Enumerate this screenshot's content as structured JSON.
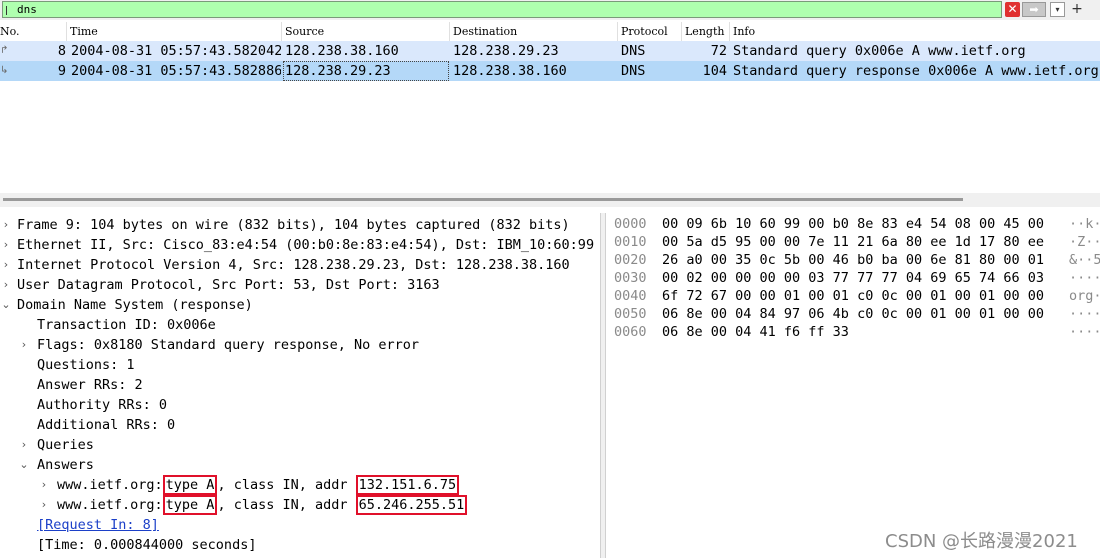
{
  "filter": {
    "value": "dns",
    "clear_icon": "✕",
    "apply_icon": "➡",
    "dropdown_icon": "▾",
    "add_icon": "+"
  },
  "columns": {
    "no": "No.",
    "time": "Time",
    "source": "Source",
    "destination": "Destination",
    "protocol": "Protocol",
    "length": "Length",
    "info": "Info"
  },
  "packets": [
    {
      "no": "8",
      "time": "2004-08-31 05:57:43.582042",
      "source": "128.238.38.160",
      "destination": "128.238.29.23",
      "protocol": "DNS",
      "length": "72",
      "info": "Standard query 0x006e A www.ietf.org"
    },
    {
      "no": "9",
      "time": "2004-08-31 05:57:43.582886",
      "source": "128.238.29.23",
      "destination": "128.238.38.160",
      "protocol": "DNS",
      "length": "104",
      "info": "Standard query response 0x006e A www.ietf.org"
    }
  ],
  "details": {
    "frame": "Frame 9: 104 bytes on wire (832 bits), 104 bytes captured (832 bits)",
    "ethernet": "Ethernet II, Src: Cisco_83:e4:54 (00:b0:8e:83:e4:54), Dst: IBM_10:60:99 (",
    "ip": "Internet Protocol Version 4, Src: 128.238.29.23, Dst: 128.238.38.160",
    "udp": "User Datagram Protocol, Src Port: 53, Dst Port: 3163",
    "dns": "Domain Name System (response)",
    "transaction_id": "Transaction ID: 0x006e",
    "flags": "Flags: 0x8180 Standard query response, No error",
    "questions": "Questions: 1",
    "answer_rrs": "Answer RRs: 2",
    "authority_rrs": "Authority RRs: 0",
    "additional_rrs": "Additional RRs: 0",
    "queries": "Queries",
    "answers": "Answers",
    "answer_list": [
      {
        "name": "www.ietf.org:",
        "type": "type A",
        "class": ", class IN, addr",
        "addr": "132.151.6.75"
      },
      {
        "name": "www.ietf.org:",
        "type": "type A",
        "class": ", class IN, addr",
        "addr": "65.246.255.51"
      }
    ],
    "request_in": "[Request In: 8]",
    "time": "[Time: 0.000844000 seconds]"
  },
  "bytes": [
    {
      "offset": "0000",
      "hex": "00 09 6b 10 60 99 00 b0  8e 83 e4 54 08 00 45 00",
      "ascii": "··k·"
    },
    {
      "offset": "0010",
      "hex": "00 5a d5 95 00 00 7e 11  21 6a 80 ee 1d 17 80 ee",
      "ascii": "·Z··"
    },
    {
      "offset": "0020",
      "hex": "26 a0 00 35 0c 5b 00 46  b0 ba 00 6e 81 80 00 01",
      "ascii": "&··5"
    },
    {
      "offset": "0030",
      "hex": "00 02 00 00 00 00 03 77  77 77 04 69 65 74 66 03",
      "ascii": "····"
    },
    {
      "offset": "0040",
      "hex": "6f 72 67 00 00 01 00 01  c0 0c 00 01 00 01 00 00",
      "ascii": "org·"
    },
    {
      "offset": "0050",
      "hex": "06 8e 00 04 84 97 06 4b  c0 0c 00 01 00 01 00 00",
      "ascii": "····"
    },
    {
      "offset": "0060",
      "hex": "06 8e 00 04 41 f6 ff 33",
      "ascii": "····"
    }
  ],
  "watermark": "CSDN @长路漫漫2021"
}
